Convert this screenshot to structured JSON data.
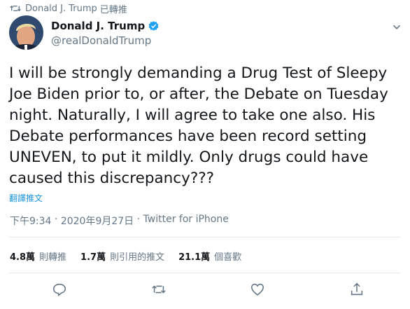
{
  "retweet": {
    "icon": "retweet-icon",
    "author": "Donald J. Trump",
    "suffix": "已轉推"
  },
  "user": {
    "name": "Donald J. Trump",
    "handle": "@realDonaldTrump",
    "avatar_icon": "profile-avatar",
    "verified_icon": "verified-badge-icon",
    "verified_color": "#1da1f2"
  },
  "tweet": {
    "text": "I will be strongly demanding a Drug Test of Sleepy\nJoe Biden prior to, or after, the Debate on Tuesday\nnight. Naturally, I will agree to take one also. His\nDebate performances have been record setting\nUNEVEN, to put it mildly. Only drugs could have\ncaused this discrepancy???",
    "translate_label": "翻譯推文",
    "time": "下午9:34",
    "sep1": " · ",
    "date": "2020年9月27日",
    "sep2": " · ",
    "source": "Twitter for iPhone"
  },
  "stats": [
    {
      "value": "4.8萬",
      "label": "則轉推"
    },
    {
      "value": "1.7萬",
      "label": "則引用的推文"
    },
    {
      "value": "21.1萬",
      "label": "個喜歡"
    }
  ],
  "actions": [
    {
      "name": "reply",
      "icon": "reply-icon"
    },
    {
      "name": "retweet",
      "icon": "retweet-icon"
    },
    {
      "name": "like",
      "icon": "like-icon"
    },
    {
      "name": "share",
      "icon": "share-icon"
    }
  ],
  "colors": {
    "link": "#1b95e0",
    "secondary_text": "#657786",
    "primary_text": "#14171a",
    "divider": "#e6ecf0"
  }
}
